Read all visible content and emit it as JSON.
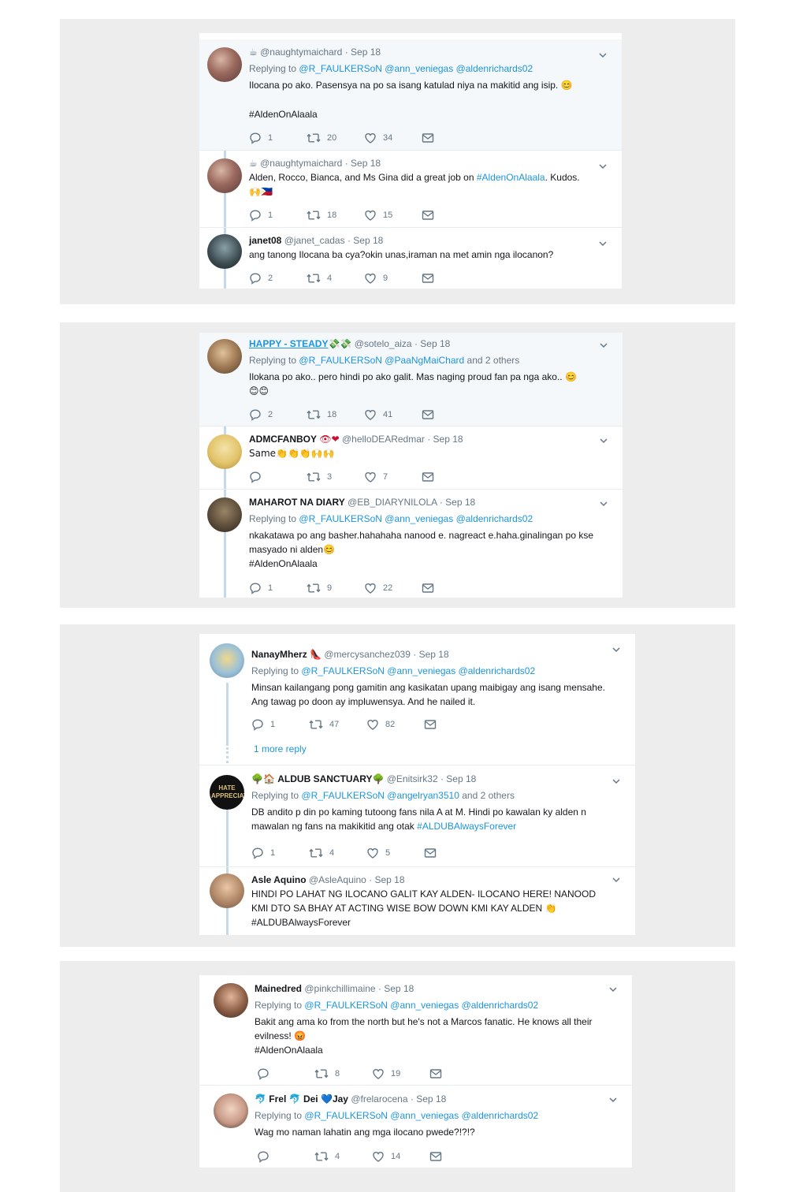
{
  "icons": {
    "reply": "reply-icon",
    "retweet": "retweet-icon",
    "like": "heart-icon",
    "dm": "envelope-icon",
    "caret": "chevron-down-icon"
  },
  "colors": {
    "link": "#1b95e0",
    "muted": "#657786",
    "thread_line": "#c4d9ea",
    "panel_bg": "#ededed"
  },
  "t1": {
    "prefix": "☕",
    "handle": "@naughtymaichard",
    "date": "· Sep 18",
    "replying": "Replying to",
    "m1": "@R_FAULKERSoN",
    "m2": "@ann_veniegas",
    "m3": "@aldenrichards02",
    "text": "Ilocana po ako. Pasensya na po sa isang katulad niya na makitid ang isip. 😊",
    "hashtag": "#AldenOnAlaala",
    "replies": "1",
    "retweets": "20",
    "likes": "34"
  },
  "t2": {
    "prefix": "☕",
    "handle": "@naughtymaichard",
    "date": "· Sep 18",
    "text_a": "Alden, Rocco, Bianca, and Ms Gina did a great job on",
    "hashtag": "#AldenOnAlaala",
    "text_b": ". Kudos.",
    "text_c": "🙌🇵🇭",
    "replies": "1",
    "retweets": "18",
    "likes": "15"
  },
  "t3": {
    "name": "janet08",
    "handle": "@janet_cadas",
    "date": "· Sep 18",
    "text": "ang tanong Ilocana ba cya?okin unas,iraman na met amin nga ilocanon?",
    "replies": "2",
    "retweets": "4",
    "likes": "9"
  },
  "t4": {
    "name": "HAPPY - STEADY",
    "name_emoji": "💸💸",
    "handle": "@sotelo_aiza",
    "date": "· Sep 18",
    "replying": "Replying to",
    "m1": "@R_FAULKERSoN",
    "m2": "@PaaNgMaiChard",
    "others": "and 2 others",
    "text": "Ilokana po ako.. pero hindi  po ako galit. Mas naging proud fan pa nga ako.. 😊",
    "text2": "😊😊",
    "replies": "2",
    "retweets": "18",
    "likes": "41"
  },
  "t5": {
    "name": "ADMCFANBOY",
    "name_emoji": "👁❤",
    "handle": "@helloDEARedmar",
    "date": "· Sep 18",
    "text": "Same👏👏👏🙌🙌",
    "replies": "",
    "retweets": "3",
    "likes": "7"
  },
  "t6": {
    "name": "MAHAROT NA DIARY",
    "handle": "@EB_DIARYNILOLA",
    "date": "· Sep 18",
    "replying": "Replying to",
    "m1": "@R_FAULKERSoN",
    "m2": "@ann_veniegas",
    "m3": "@aldenrichards02",
    "text": "nkakatawa po ang basher.hahahaha nanood e. nagreact e.haha.ginalingan po kse masyado ni alden😊",
    "hashtag": "#AldenOnAlaala",
    "replies": "1",
    "retweets": "9",
    "likes": "22"
  },
  "t7": {
    "name": "NanayMherz",
    "name_emoji": "👠",
    "handle": "@mercysanchez039",
    "date": "· Sep 18",
    "replying": "Replying to",
    "m1": "@R_FAULKERSoN",
    "m2": "@ann_veniegas",
    "m3": "@aldenrichards02",
    "text": "Minsan kailangang pong gamitin ang kasikatan upang maibigay ang isang mensahe. Ang tawag po doon ay impluwensya. And he nailed it.",
    "replies": "1",
    "retweets": "47",
    "likes": "82",
    "more": "1 more reply"
  },
  "t8": {
    "name_prefix": "🌳🏠",
    "name": "ALDUB SANCTUARY",
    "name_emoji": "🌳",
    "handle": "@Enitsirk32",
    "date": "· Sep 18",
    "replying": "Replying to",
    "m1": "@R_FAULKERSoN",
    "m2": "@angelryan3510",
    "others": "and 2 others",
    "text": "DB andito p din po kaming tutoong fans nila A at M. Hindi po kawalan ky alden n mawalan ng fans na makikitid ang otak",
    "hashtag": "#ALDUBAlwaysForever",
    "replies": "1",
    "retweets": "4",
    "likes": "5",
    "avatar_text": "HATE APPRECIATE"
  },
  "t9": {
    "name": "Asle Aquino",
    "handle": "@AsleAquino",
    "date": "· Sep 18",
    "text": "HINDI PO LAHAT NG ILOCANO GALIT KAY ALDEN- ILOCANO HERE! NANOOD KMI DTO SA BHAY AT ACTING WISE BOW DOWN KMI KAY ALDEN 👏",
    "hashtag": "#ALDUBAlwaysForever"
  },
  "t10": {
    "name": "Mainedred",
    "handle": "@pinkchillimaine",
    "date": "· Sep 18",
    "replying": "Replying to",
    "m1": "@R_FAULKERSoN",
    "m2": "@ann_veniegas",
    "m3": "@aldenrichards02",
    "text": "Bakit ang ama ko from the north but he's not a Marcos fanatic. He knows all their evilness! 😡",
    "hashtag": "#AldenOnAlaala",
    "replies": "",
    "retweets": "8",
    "likes": "19"
  },
  "t11": {
    "n1": "Frel",
    "n2": "Dei",
    "n3": "Jay",
    "e1": "🐬",
    "e2": "🐬",
    "e3": "💙",
    "handle": "@frelarocena",
    "date": "· Sep 18",
    "replying": "Replying to",
    "m1": "@R_FAULKERSoN",
    "m2": "@ann_veniegas",
    "m3": "@aldenrichards02",
    "text": "Wag mo naman lahatin ang mga ilocano pwede?!?!?",
    "replies": "",
    "retweets": "4",
    "likes": "14"
  }
}
